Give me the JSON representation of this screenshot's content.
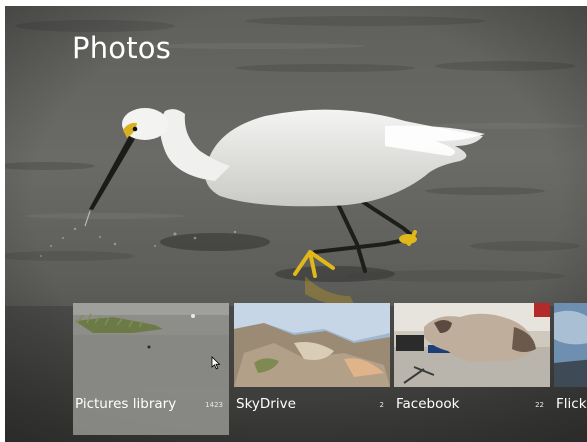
{
  "app": {
    "title": "Photos"
  },
  "tiles": [
    {
      "label": "Pictures library",
      "count": "1423",
      "icon": "pictures-library-thumbnail"
    },
    {
      "label": "SkyDrive",
      "count": "2",
      "icon": "skydrive-thumbnail"
    },
    {
      "label": "Facebook",
      "count": "22",
      "icon": "facebook-thumbnail"
    },
    {
      "label": "Flickr",
      "count": "",
      "icon": "flickr-thumbnail"
    }
  ],
  "colors": {
    "background": "#5b5b59",
    "tile_selected": "#9a9a96",
    "text": "#ffffff"
  }
}
